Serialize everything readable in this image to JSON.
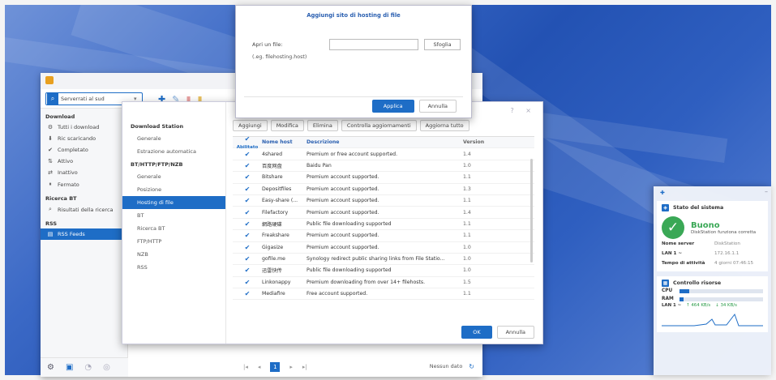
{
  "download_station": {
    "search_text": "Serverrati al sud",
    "sidebar": {
      "download_header": "Download",
      "download_items": [
        {
          "label": "Tutti i download",
          "icon": "download-all-icon",
          "glyph": "⚙"
        },
        {
          "label": "Ric scaricando",
          "icon": "downloading-icon",
          "glyph": "⬇"
        },
        {
          "label": "Completato",
          "icon": "completed-icon",
          "glyph": "✔"
        },
        {
          "label": "Attivo",
          "icon": "active-icon",
          "glyph": "⇅"
        },
        {
          "label": "Inattivo",
          "icon": "inactive-icon",
          "glyph": "⇄"
        },
        {
          "label": "Fermato",
          "icon": "stopped-icon",
          "glyph": "⏸"
        }
      ],
      "bt_header": "Ricerca BT",
      "bt_items": [
        {
          "label": "Risultati della ricerca",
          "icon": "search-results-icon",
          "glyph": "⌕"
        }
      ],
      "rss_header": "RSS",
      "rss_items": [
        {
          "label": "RSS Feeds",
          "icon": "rss-icon",
          "glyph": "▤"
        }
      ]
    },
    "pager_current": "1",
    "status_text": "Nessun dato"
  },
  "settings": {
    "nav": {
      "header_1": "Download Station",
      "items_1": [
        "Generale",
        "Estrazione automatica"
      ],
      "header_2": "BT/HTTP/FTP/NZB",
      "items_2": [
        "Generale",
        "Posizione",
        "Hosting di file",
        "BT",
        "Ricerca BT",
        "FTP/HTTP",
        "NZB",
        "RSS"
      ],
      "selected": "Hosting di file"
    },
    "toolbar": [
      "Aggiungi",
      "Modifica",
      "Elimina",
      "Controlla aggiornamenti",
      "Aggiorna tutto"
    ],
    "columns": {
      "enabled": "Abilitato",
      "name": "Nome host",
      "desc": "Descrizione",
      "version": "Version"
    },
    "rows": [
      {
        "name": "4shared",
        "desc": "Premium or free account supported.",
        "version": "1.4"
      },
      {
        "name": "百度网盘",
        "desc": "Baidu Pan",
        "version": "1.0"
      },
      {
        "name": "Bitshare",
        "desc": "Premium account supported.",
        "version": "1.1"
      },
      {
        "name": "Depositfiles",
        "desc": "Premium account supported.",
        "version": "1.3"
      },
      {
        "name": "Easy-share (...",
        "desc": "Premium account supported.",
        "version": "1.1"
      },
      {
        "name": "Filefactory",
        "desc": "Premium account supported.",
        "version": "1.4"
      },
      {
        "name": "網路硬碟",
        "desc": "Public file downloading supported",
        "version": "1.1"
      },
      {
        "name": "Freakshare",
        "desc": "Premium account supported.",
        "version": "1.1"
      },
      {
        "name": "Gigasize",
        "desc": "Premium account supported.",
        "version": "1.0"
      },
      {
        "name": "gofile.me",
        "desc": "Synology redirect public sharing links from File Statio...",
        "version": "1.0"
      },
      {
        "name": "迅雷快传",
        "desc": "Public file downloading supported",
        "version": "1.0"
      },
      {
        "name": "Linkonappy",
        "desc": "Premium downloading from over 14+ filehosts.",
        "version": "1.5"
      },
      {
        "name": "Mediafire",
        "desc": "Free account supported.",
        "version": "1.1"
      }
    ],
    "ok_label": "OK",
    "cancel_label": "Annulla"
  },
  "add_host": {
    "title": "Aggiungi sito di hosting di file",
    "field_label": "Apri un file:",
    "hint": "(.eg. filehosting.host)",
    "browse_label": "Sfoglia",
    "ok_label": "Applica",
    "cancel_label": "Annulla"
  },
  "widgets": {
    "health": {
      "title": "Stato del sistema",
      "status": "Buono",
      "subtitle": "DiskStation funziona correttamente.",
      "rows": [
        {
          "k": "Nome server",
          "v": "DiskStation"
        },
        {
          "k": "LAN 1 ~",
          "v": "172.16.1.1"
        },
        {
          "k": "Tempo di attività",
          "v": "4 giorni 07:46:15"
        }
      ]
    },
    "monitor": {
      "title": "Controllo risorse",
      "cpu_label": "CPU",
      "cpu_percent": 12,
      "ram_label": "RAM",
      "ram_percent": 5,
      "lan_label": "LAN 1 ~",
      "up": "↑ 464 KB/s",
      "down": "↓ 34 KB/s"
    },
    "colors": {
      "accent": "#1e6dc6",
      "good": "#3aa856"
    }
  }
}
